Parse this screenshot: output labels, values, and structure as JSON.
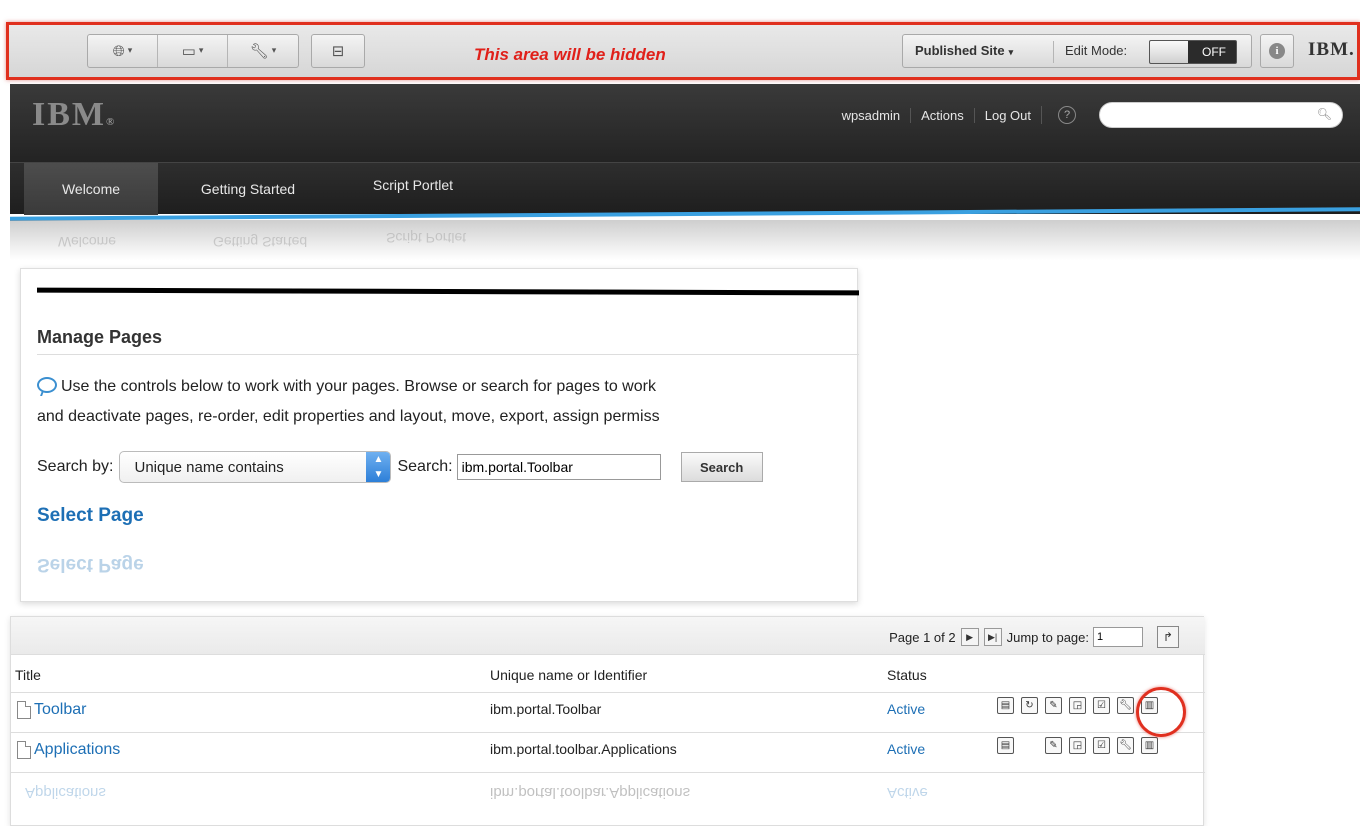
{
  "toolbar": {
    "hidden_note": "This area will be hidden",
    "group1": [
      {
        "icon": "globe-icon",
        "glyph": "🌐︎",
        "caret": "▾"
      },
      {
        "icon": "device-icon",
        "glyph": "▭",
        "caret": "▾"
      },
      {
        "icon": "wrench-icon",
        "glyph": "🔧︎",
        "caret": "▾"
      }
    ],
    "site_toolbar_icon": "⊟",
    "published_site": "Published Site",
    "caret": "▾",
    "edit_mode_label": "Edit Mode:",
    "edit_mode_value": "OFF",
    "info_glyph": "i",
    "brand": "IBM."
  },
  "header": {
    "logo": "IBM",
    "logo_reg": "®",
    "user": "wpsadmin",
    "actions": "Actions",
    "logout": "Log Out",
    "help_glyph": "?",
    "search_placeholder": "",
    "search_glyph": "🔍︎"
  },
  "nav": {
    "tabs": [
      "Welcome",
      "Getting Started",
      "Script Portlet"
    ],
    "active_index": 0
  },
  "manage": {
    "title": "Manage Pages",
    "desc_line1": "Use the controls below to work with your pages. Browse or search for pages to work",
    "desc_line2": "and deactivate pages, re-order, edit properties and layout, move, export, assign permiss",
    "search_by_label": "Search by:",
    "search_by_value": "Unique name contains",
    "search_label": "Search:",
    "search_value": "ibm.portal.Toolbar",
    "search_button": "Search",
    "select_page": "Select Page"
  },
  "table": {
    "page_info": "Page 1 of 2",
    "jump_label": "Jump to page:",
    "jump_value": "1",
    "columns": [
      "Title",
      "Unique name or Identifier",
      "Status"
    ],
    "rows": [
      {
        "title": "Toolbar",
        "uid": "ibm.portal.Toolbar",
        "status": "Active"
      },
      {
        "title": "Applications",
        "uid": "ibm.portal.toolbar.Applications",
        "status": "Active"
      }
    ]
  },
  "accent": {
    "highlight": "#e03020",
    "link": "#1d6fb5",
    "nav_line": "#3aa0e0"
  }
}
